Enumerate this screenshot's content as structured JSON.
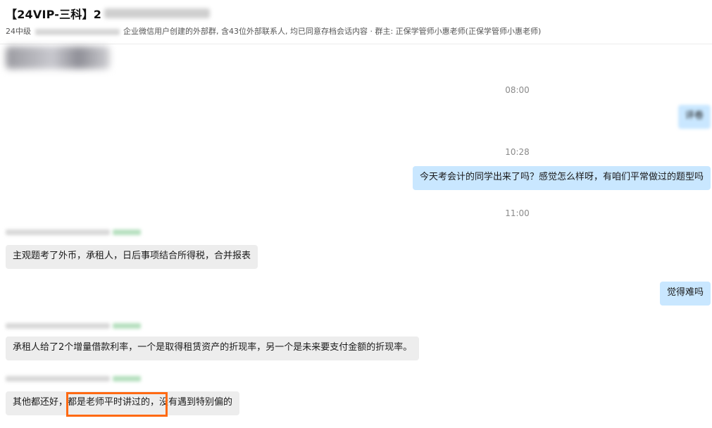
{
  "header": {
    "title": "【24VIP-三科】2",
    "subtitle_prefix": "24中级",
    "subtitle_main": "企业微信用户创建的外部群, 含43位外部联系人, 均已同意存档会话内容 · 群主: 正保学管师小惠老师(正保学管师小惠老师)"
  },
  "times": [
    "08:00",
    "10:28",
    "11:00"
  ],
  "messages": [
    {
      "side": "right",
      "text": "评卷"
    },
    {
      "side": "right",
      "text": "今天考会计的同学出来了吗？感觉怎么样呀，有咱们平常做过的题型吗"
    },
    {
      "side": "left",
      "text": "主观题考了外币，承租人，日后事项结合所得税，合并报表"
    },
    {
      "side": "right",
      "text": "觉得难吗"
    },
    {
      "side": "left",
      "text": "承租人给了2个增量借款利率，一个是取得租赁资产的折现率，另一个是未来要支付金额的折现率。"
    },
    {
      "side": "left",
      "text_before": "其他都还好，",
      "text_highlight": "都是老师平时讲过的",
      "text_after": "，没有遇到特别偏的"
    }
  ],
  "colors": {
    "right_bubble": "#c9e7ff",
    "left_bubble": "#ededed",
    "highlight_border": "#ff6a13"
  }
}
